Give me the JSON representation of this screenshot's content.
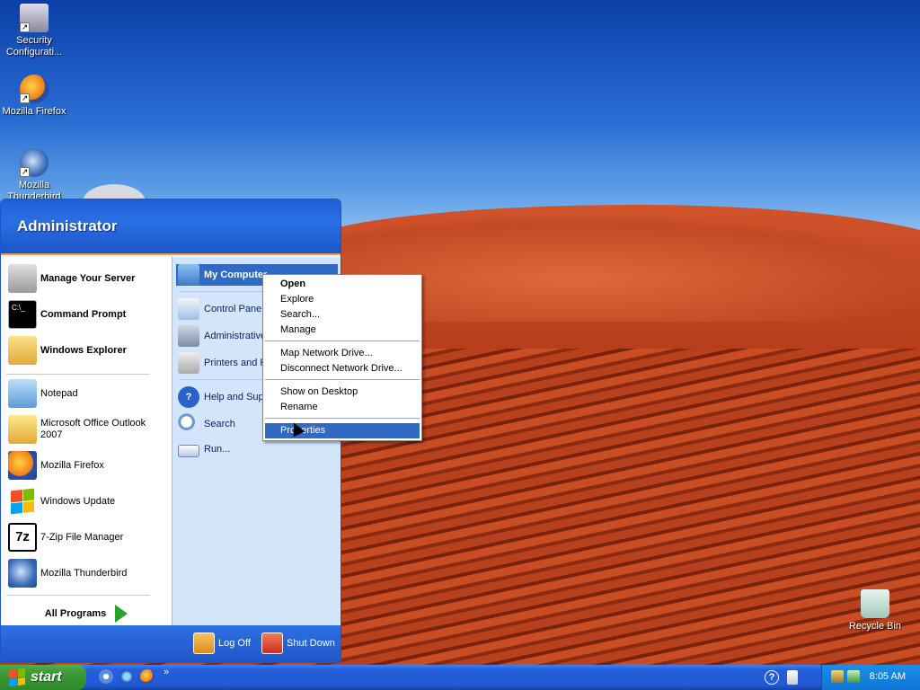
{
  "desktop": {
    "icons": [
      {
        "label": "Security Configurati...",
        "icon": "security-config-icon"
      },
      {
        "label": "Mozilla Firefox",
        "icon": "firefox-icon"
      },
      {
        "label": "Mozilla Thunderbird",
        "icon": "thunderbird-icon"
      },
      {
        "label": "Recycle Bin",
        "icon": "recycle-bin-icon"
      }
    ]
  },
  "start_menu": {
    "user": "Administrator",
    "left_items": [
      {
        "label": "Manage Your Server",
        "bold": true,
        "icon": "server-icon"
      },
      {
        "label": "Command Prompt",
        "bold": true,
        "icon": "cmd-icon"
      },
      {
        "label": "Windows Explorer",
        "bold": true,
        "icon": "explorer-icon"
      },
      {
        "label": "Notepad",
        "icon": "notepad-icon"
      },
      {
        "label": "Microsoft Office Outlook 2007",
        "icon": "outlook-icon"
      },
      {
        "label": "Mozilla Firefox",
        "icon": "firefox-icon"
      },
      {
        "label": "Windows Update",
        "icon": "windows-update-icon"
      },
      {
        "label": "7-Zip File Manager",
        "icon": "7zip-icon"
      },
      {
        "label": "Mozilla Thunderbird",
        "icon": "thunderbird-icon"
      }
    ],
    "all_programs": "All Programs",
    "right_items": [
      {
        "label": "My Computer",
        "icon": "computer-icon"
      },
      {
        "label": "Control Panel",
        "icon": "control-panel-icon"
      },
      {
        "label": "Administrative",
        "icon": "admin-tools-icon"
      },
      {
        "label": "Printers and F",
        "icon": "printer-icon"
      },
      {
        "label": "Help and Supp",
        "icon": "help-icon"
      },
      {
        "label": "Search",
        "icon": "search-icon"
      },
      {
        "label": "Run...",
        "icon": "run-icon"
      }
    ],
    "log_off": "Log Off",
    "shut_down": "Shut Down"
  },
  "context_menu": {
    "items": [
      "Open",
      "Explore",
      "Search...",
      "Manage",
      "Map Network Drive...",
      "Disconnect Network Drive...",
      "Show on Desktop",
      "Rename",
      "Properties"
    ],
    "selected": "Properties"
  },
  "taskbar": {
    "start": "start",
    "clock": "8:05 AM",
    "chevron": "»"
  }
}
